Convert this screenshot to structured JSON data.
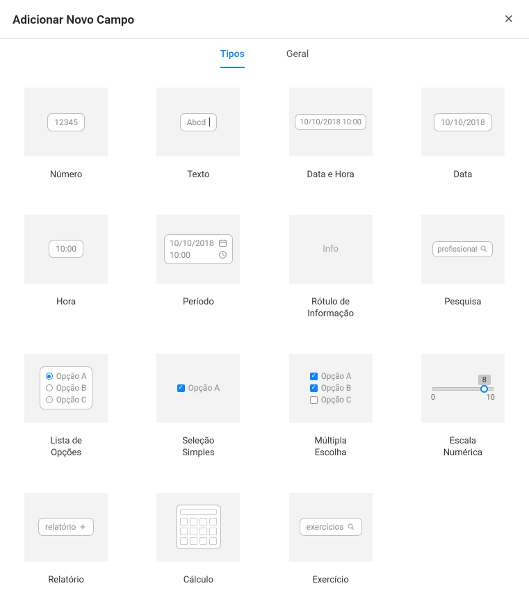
{
  "header": {
    "title": "Adicionar Novo Campo"
  },
  "tabs": {
    "types": "Tipos",
    "general": "Geral",
    "active": "types"
  },
  "items": {
    "number": {
      "label": "Número",
      "sample": "12345"
    },
    "text": {
      "label": "Texto",
      "sample": "Abcd"
    },
    "datetime": {
      "label": "Data e Hora",
      "sample": "10/10/2018 10:00"
    },
    "date": {
      "label": "Data",
      "sample": "10/10/2018"
    },
    "time": {
      "label": "Hora",
      "sample": "10:00"
    },
    "period": {
      "label": "Período",
      "line1": "10/10/2018",
      "line2": "10:00"
    },
    "info": {
      "label": "Rótulo de\nInformação",
      "sample": "Info"
    },
    "search": {
      "label": "Pesquisa",
      "sample": "profissional"
    },
    "options": {
      "label": "Lista de\nOpções",
      "opts": [
        "Opção A",
        "Opção B",
        "Opção C"
      ]
    },
    "single": {
      "label": "Seleção\nSimples",
      "opt": "Opção A"
    },
    "multi": {
      "label": "Múltipla\nEscolha",
      "opts": [
        "Opção A",
        "Opção B",
        "Opção C"
      ]
    },
    "scale": {
      "label": "Escala\nNumérica",
      "value": "8",
      "min": "0",
      "max": "10"
    },
    "report": {
      "label": "Relatório",
      "sample": "relatório"
    },
    "calc": {
      "label": "Cálculo"
    },
    "exercise": {
      "label": "Exercício",
      "sample": "exercícios"
    }
  }
}
